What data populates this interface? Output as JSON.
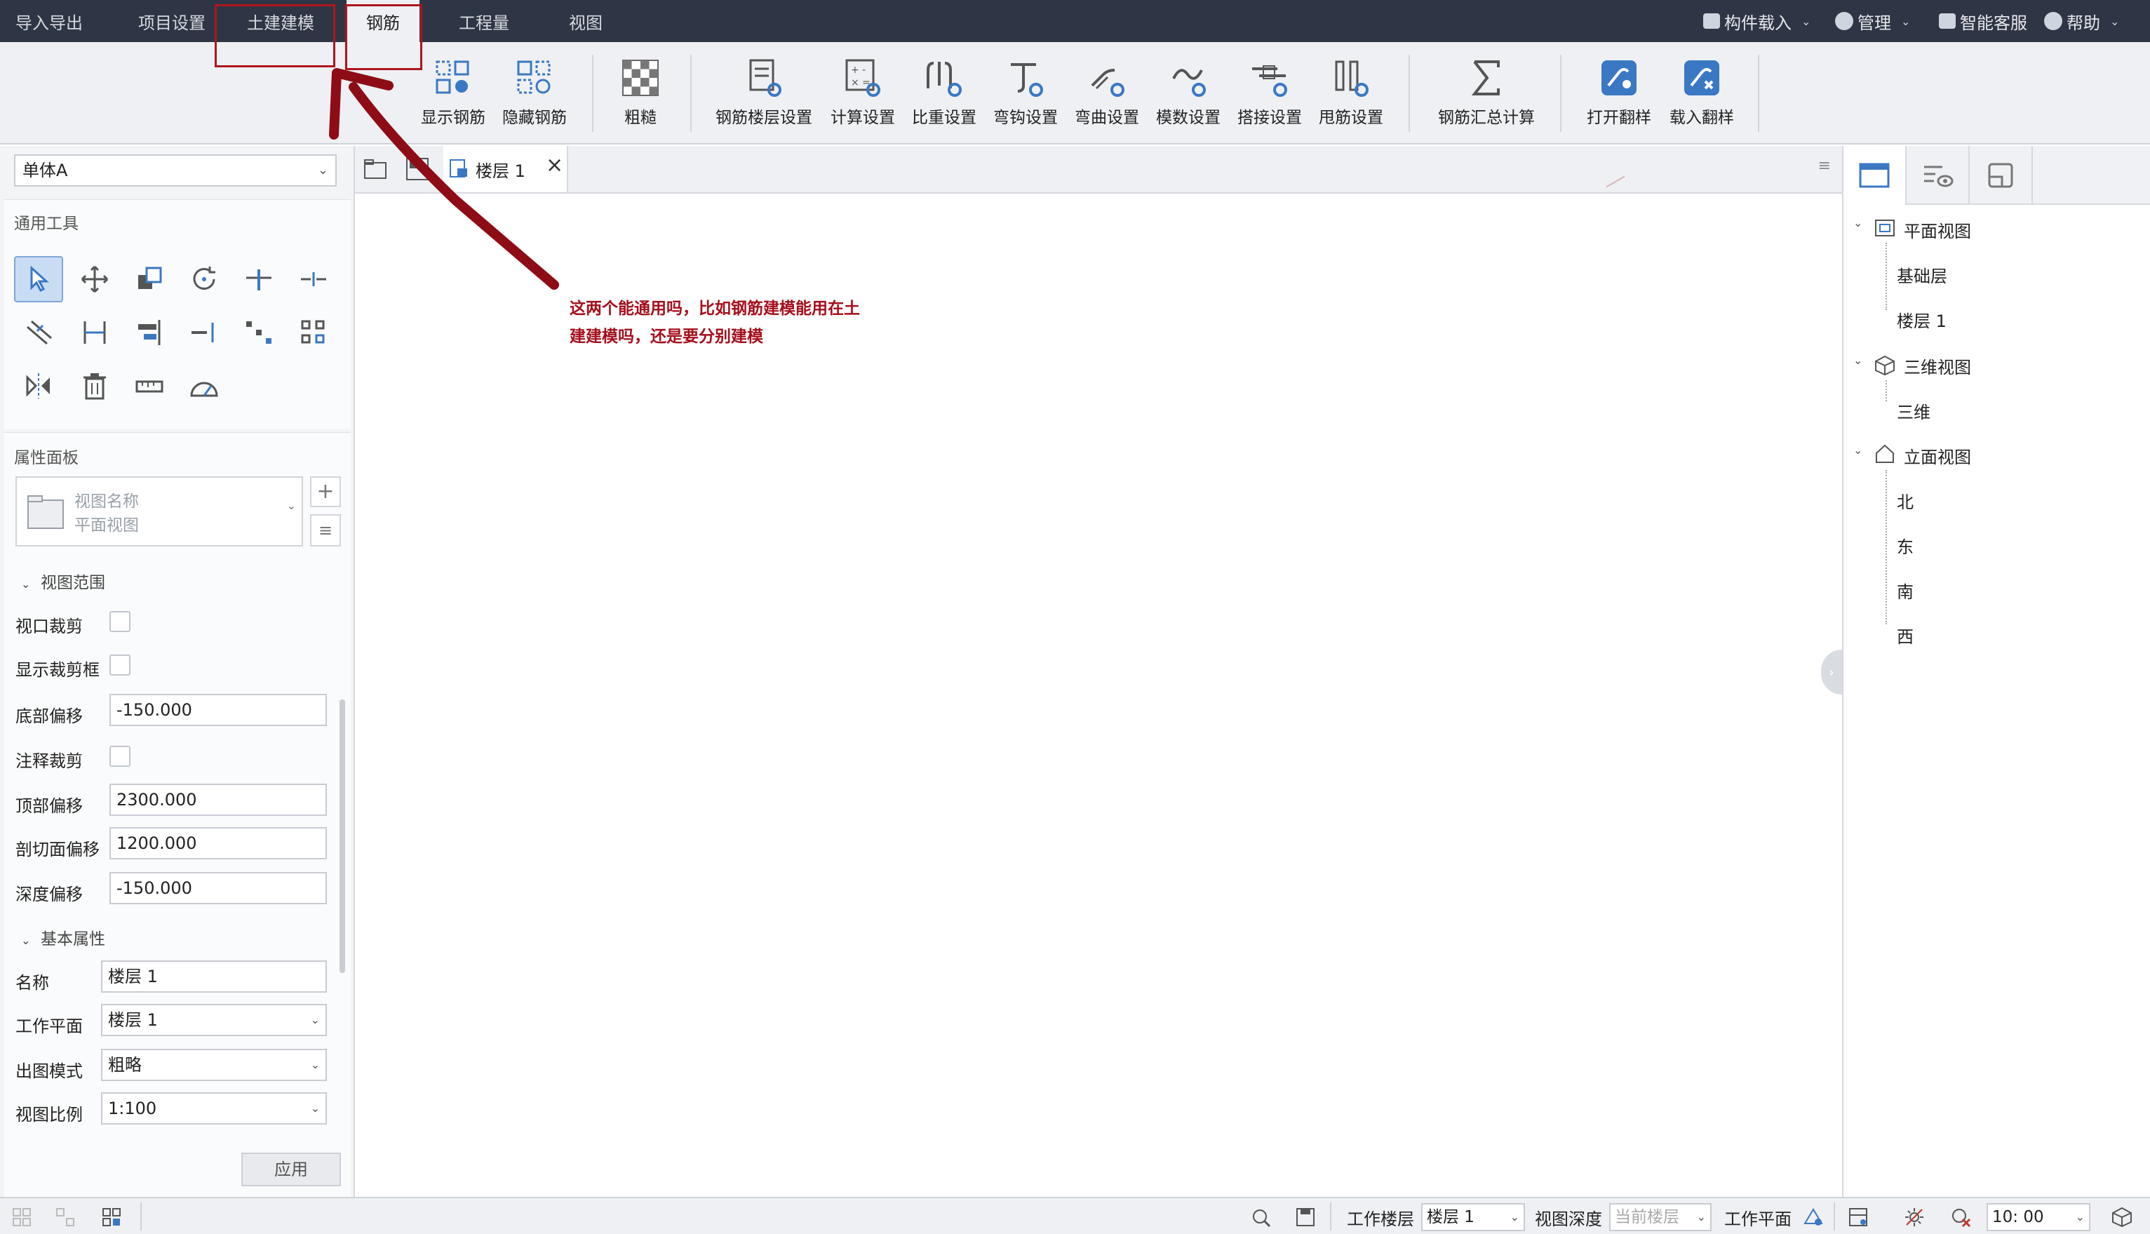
{
  "menu": {
    "tabs": [
      "导入导出",
      "项目设置",
      "土建建模",
      "钢筋",
      "工程量",
      "视图"
    ],
    "active_tab": "钢筋",
    "right": {
      "component_load": "构件载入",
      "manage": "管理",
      "smart_service": "智能客服",
      "help": "帮助"
    }
  },
  "ribbon": {
    "buttons": [
      "显示钢筋",
      "隐藏钢筋",
      "粗糙",
      "钢筋楼层设置",
      "计算设置",
      "比重设置",
      "弯钩设置",
      "弯曲设置",
      "模数设置",
      "搭接设置",
      "甩筋设置",
      "钢筋汇总计算",
      "打开翻样",
      "载入翻样"
    ]
  },
  "left": {
    "unit_select": "单体A",
    "tools_title": "通用工具",
    "props_title": "属性面板",
    "view_name_label": "视图名称",
    "view_name_value": "平面视图",
    "group_view_range": "视图范围",
    "group_basic": "基本属性",
    "props": {
      "viewport_crop": "视口裁剪",
      "show_crop_box": "显示裁剪框",
      "bottom_offset_label": "底部偏移",
      "bottom_offset": "-150.000",
      "annotation_crop": "注释裁剪",
      "top_offset_label": "顶部偏移",
      "top_offset": "2300.000",
      "cut_offset_label": "剖切面偏移",
      "cut_offset": "1200.000",
      "depth_offset_label": "深度偏移",
      "depth_offset": "-150.000",
      "name_label": "名称",
      "name": "楼层 1",
      "work_plane_label": "工作平面",
      "work_plane": "楼层 1",
      "output_mode_label": "出图模式",
      "output_mode": "粗略",
      "scale_label": "视图比例",
      "scale": "1:100"
    },
    "apply": "应用"
  },
  "canvas": {
    "tab_label": "楼层 1",
    "note_line1": "这两个能通用吗，比如钢筋建模能用在土",
    "note_line2": "建建模吗，还是要分别建模"
  },
  "tree": {
    "plan": "平面视图",
    "plan_items": [
      "基础层",
      "楼层 1"
    ],
    "view3d": "三维视图",
    "view3d_items": [
      "三维"
    ],
    "elevation": "立面视图",
    "elevation_items": [
      "北",
      "东",
      "南",
      "西"
    ]
  },
  "status": {
    "work_floor_label": "工作楼层",
    "work_floor": "楼层 1",
    "view_depth_label": "视图深度",
    "view_depth": "当前楼层",
    "work_plane_label": "工作平面",
    "time": "10: 00"
  },
  "colors": {
    "menubar": "#2e3645",
    "annotation_red": "#a50f1b",
    "icon_blue": "#3b78c4"
  }
}
